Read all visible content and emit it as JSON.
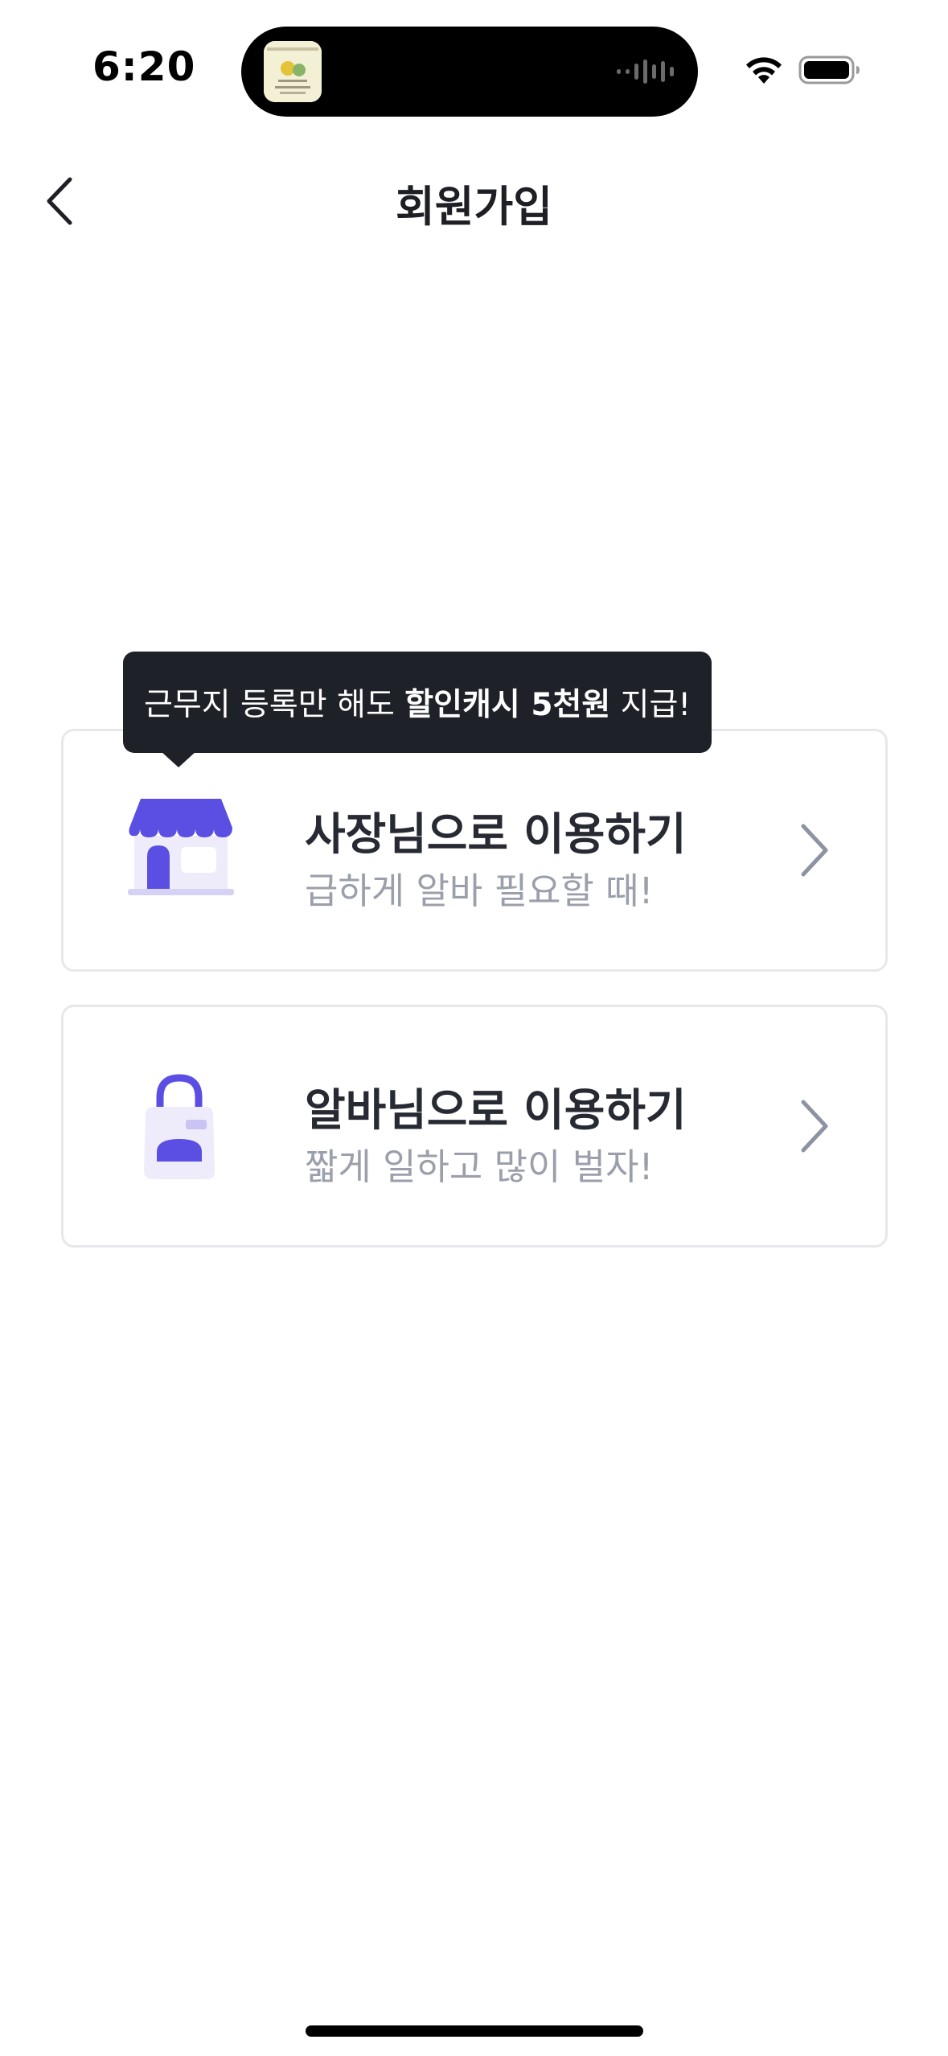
{
  "status_bar": {
    "time": "6:20",
    "wifi_icon": "wifi-icon",
    "battery_icon": "battery-icon"
  },
  "header": {
    "title": "회원가입",
    "back_icon": "chevron-left-icon"
  },
  "tooltip": {
    "text_before": "근무지 등록만 해도 ",
    "text_bold": "할인캐시 5천원",
    "text_after": " 지급!"
  },
  "options": [
    {
      "title": "사장님으로 이용하기",
      "subtitle": "급하게 알바 필요할 때!",
      "icon": "store-icon"
    },
    {
      "title": "알바님으로 이용하기",
      "subtitle": "짧게 일하고 많이 벌자!",
      "icon": "apron-icon"
    }
  ],
  "colors": {
    "accent": "#5b4fe3",
    "accent_light": "#eeecfb",
    "tooltip_bg": "#1e2128",
    "title_text": "#272a33",
    "subtitle_text": "#9a9fab",
    "card_border": "#e7e8ec",
    "chevron": "#8e93a3"
  }
}
